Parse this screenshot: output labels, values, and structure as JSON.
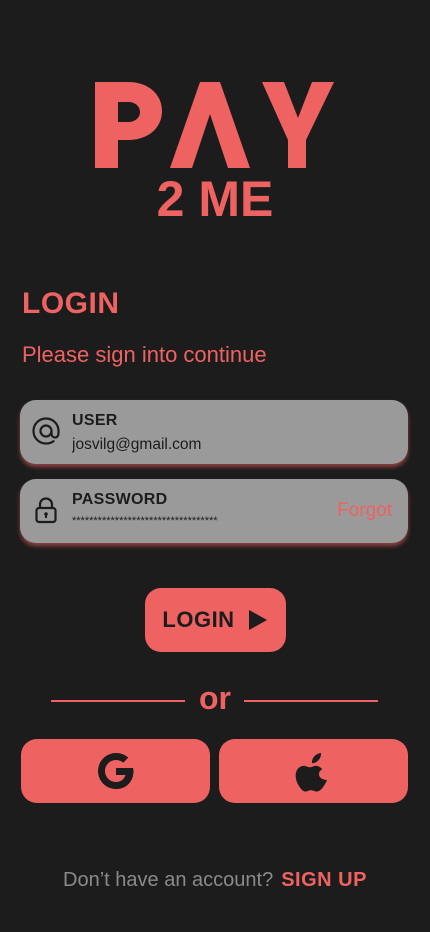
{
  "app": {
    "logo_alt": "PAY 2 ME",
    "brand_color": "#ef6262",
    "background_color": "#1c1c1c"
  },
  "header": {
    "title": "LOGIN",
    "subtitle": "Please sign into continue"
  },
  "form": {
    "user": {
      "label": "USER",
      "value": "josvilg@gmail.com",
      "icon": "at-icon"
    },
    "password": {
      "label": "PASSWORD",
      "value": "**********************************",
      "icon": "lock-icon",
      "forgot_label": "Forgot"
    },
    "login_label": "LOGIN"
  },
  "divider": {
    "text": "or"
  },
  "social": {
    "google_icon": "google-icon",
    "apple_icon": "apple-icon"
  },
  "footer": {
    "prompt": "Don’t have an account?",
    "signup_label": "SIGN UP"
  }
}
